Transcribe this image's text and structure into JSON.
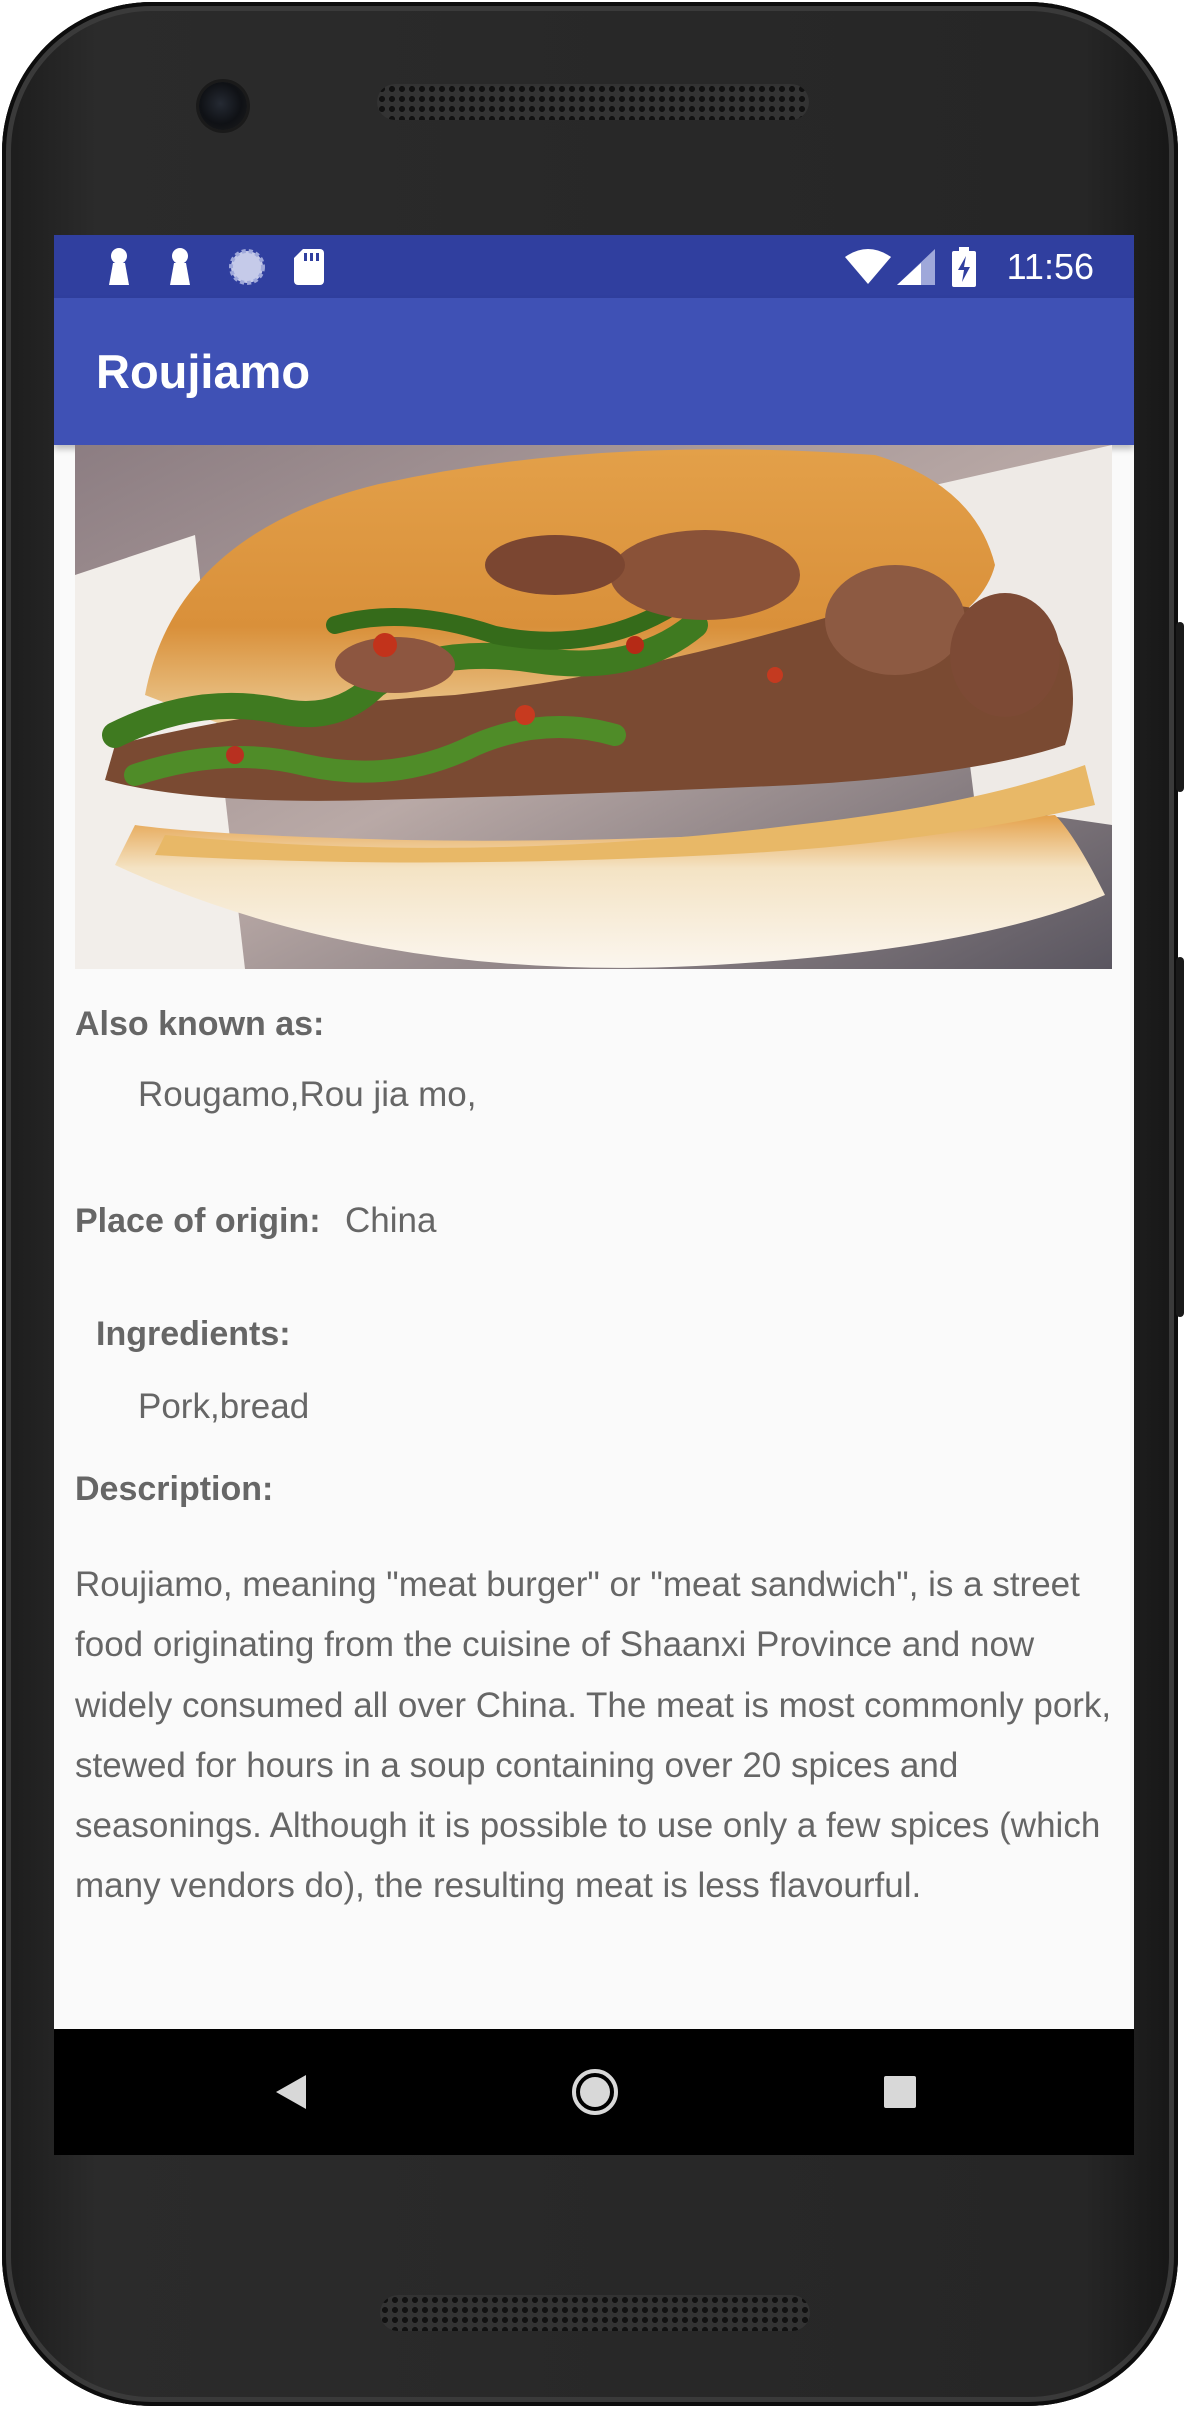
{
  "status_bar": {
    "time": "11:56",
    "left_icons": [
      "notification-icon",
      "notification-icon",
      "sync-icon",
      "sd-card-icon"
    ],
    "right_icons": [
      "wifi-icon",
      "cell-signal-icon",
      "battery-charging-icon"
    ]
  },
  "app_bar": {
    "title": "Roujiamo"
  },
  "dish": {
    "image_alt": "roujiamo-photo",
    "also_known_as_label": "Also known as:",
    "also_known_as_value": "Rougamo,Rou jia mo,",
    "origin_label": "Place of origin:",
    "origin_value": "China",
    "ingredients_label": "Ingredients:",
    "ingredients_value": "Pork,bread",
    "description_label": "Description:",
    "description_text": "Roujiamo, meaning \"meat burger\" or \"meat sandwich\", is a street food originating from the cuisine of Shaanxi Province and now widely consumed all over China. The meat is most commonly pork, stewed for hours in a soup containing over 20 spices and seasonings. Although it is possible to use only a few spices (which many vendors do), the resulting meat is less flavourful."
  },
  "nav_bar": {
    "buttons": [
      "back-icon",
      "home-icon",
      "recents-icon"
    ]
  },
  "colors": {
    "status_bar": "#303f9f",
    "app_bar": "#3f51b5",
    "background": "#fafafa",
    "text": "#666666"
  }
}
